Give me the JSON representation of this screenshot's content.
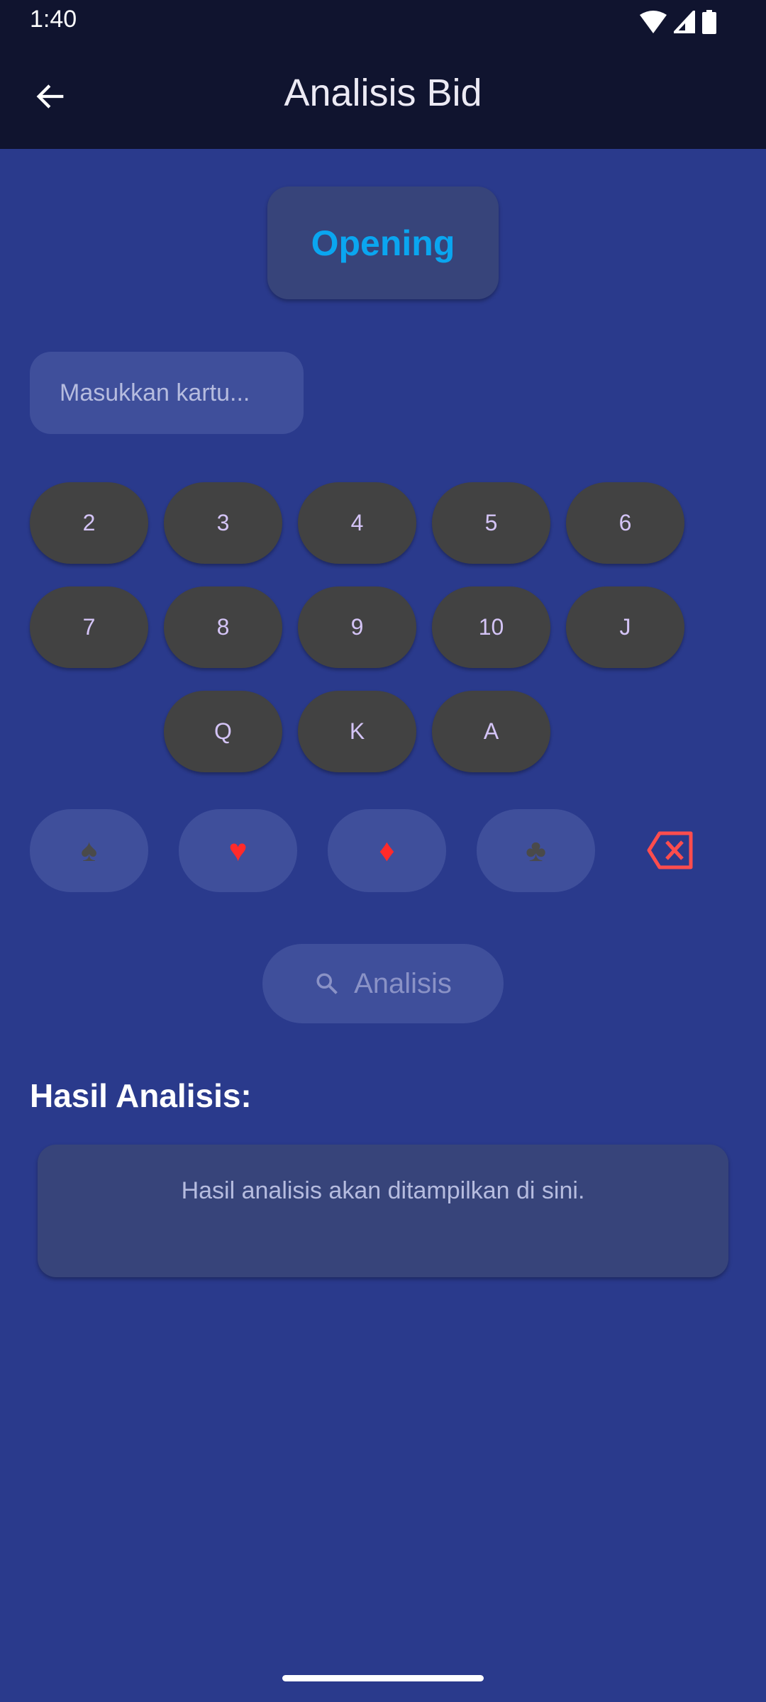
{
  "status_bar": {
    "time": "1:40"
  },
  "header": {
    "title": "Analisis Bid",
    "back_icon": "arrow-left-icon"
  },
  "mode_button": {
    "label": "Opening",
    "color": "#0aa6f0"
  },
  "card_input": {
    "placeholder": "Masukkan kartu...",
    "value": ""
  },
  "ranks": [
    "2",
    "3",
    "4",
    "5",
    "6",
    "7",
    "8",
    "9",
    "10",
    "J",
    "Q",
    "K",
    "A"
  ],
  "suits": [
    {
      "name": "spade",
      "glyph": "♠",
      "color": "#4a4a4a"
    },
    {
      "name": "heart",
      "glyph": "♥",
      "color": "#ff2a2a"
    },
    {
      "name": "diamond",
      "glyph": "♦",
      "color": "#ff2a2a"
    },
    {
      "name": "club",
      "glyph": "♣",
      "color": "#4a4a4a"
    }
  ],
  "backspace": {
    "icon": "backspace-icon",
    "color": "#ff4d4d"
  },
  "analyze_button": {
    "label": "Analisis",
    "icon": "search-icon"
  },
  "result": {
    "title": "Hasil Analisis:",
    "placeholder": "Hasil analisis akan ditampilkan di sini."
  }
}
